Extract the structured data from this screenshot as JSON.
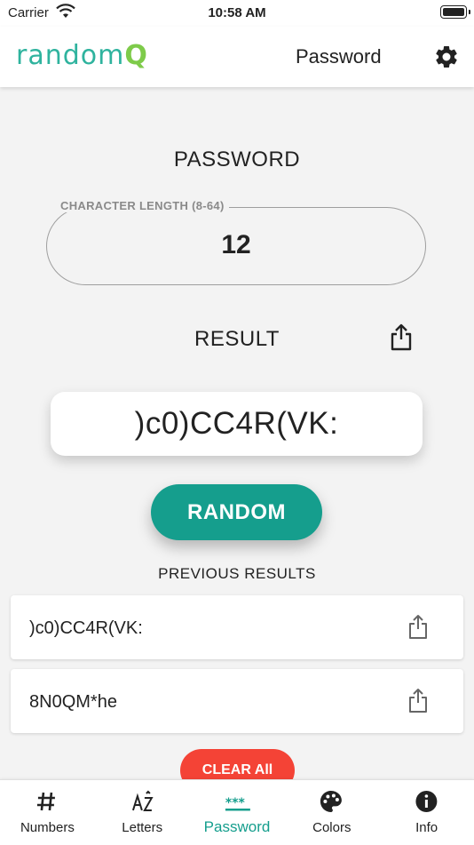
{
  "status_bar": {
    "carrier": "Carrier",
    "time": "10:58 AM"
  },
  "app_bar": {
    "logo_main": "random",
    "logo_accent": "Q",
    "title": "Password"
  },
  "main": {
    "section_title": "PASSWORD",
    "length_label": "CHARACTER LENGTH (8-64)",
    "length_value": "12",
    "result_title": "RESULT",
    "result_value": ")c0)CC4R(VK:",
    "random_button": "RANDOM",
    "previous_title": "PREVIOUS RESULTS",
    "previous_results": [
      ")c0)CC4R(VK:",
      "8N0QM*he"
    ],
    "clear_button": "CLEAR All"
  },
  "tabs": [
    {
      "label": "Numbers",
      "icon": "hash-icon"
    },
    {
      "label": "Letters",
      "icon": "az-icon"
    },
    {
      "label": "Password",
      "icon": "asterisks-icon",
      "active": true
    },
    {
      "label": "Colors",
      "icon": "palette-icon"
    },
    {
      "label": "Info",
      "icon": "info-icon"
    }
  ],
  "colors": {
    "accent": "#159e8d",
    "danger": "#f44336",
    "logo": "#2fb39e"
  }
}
